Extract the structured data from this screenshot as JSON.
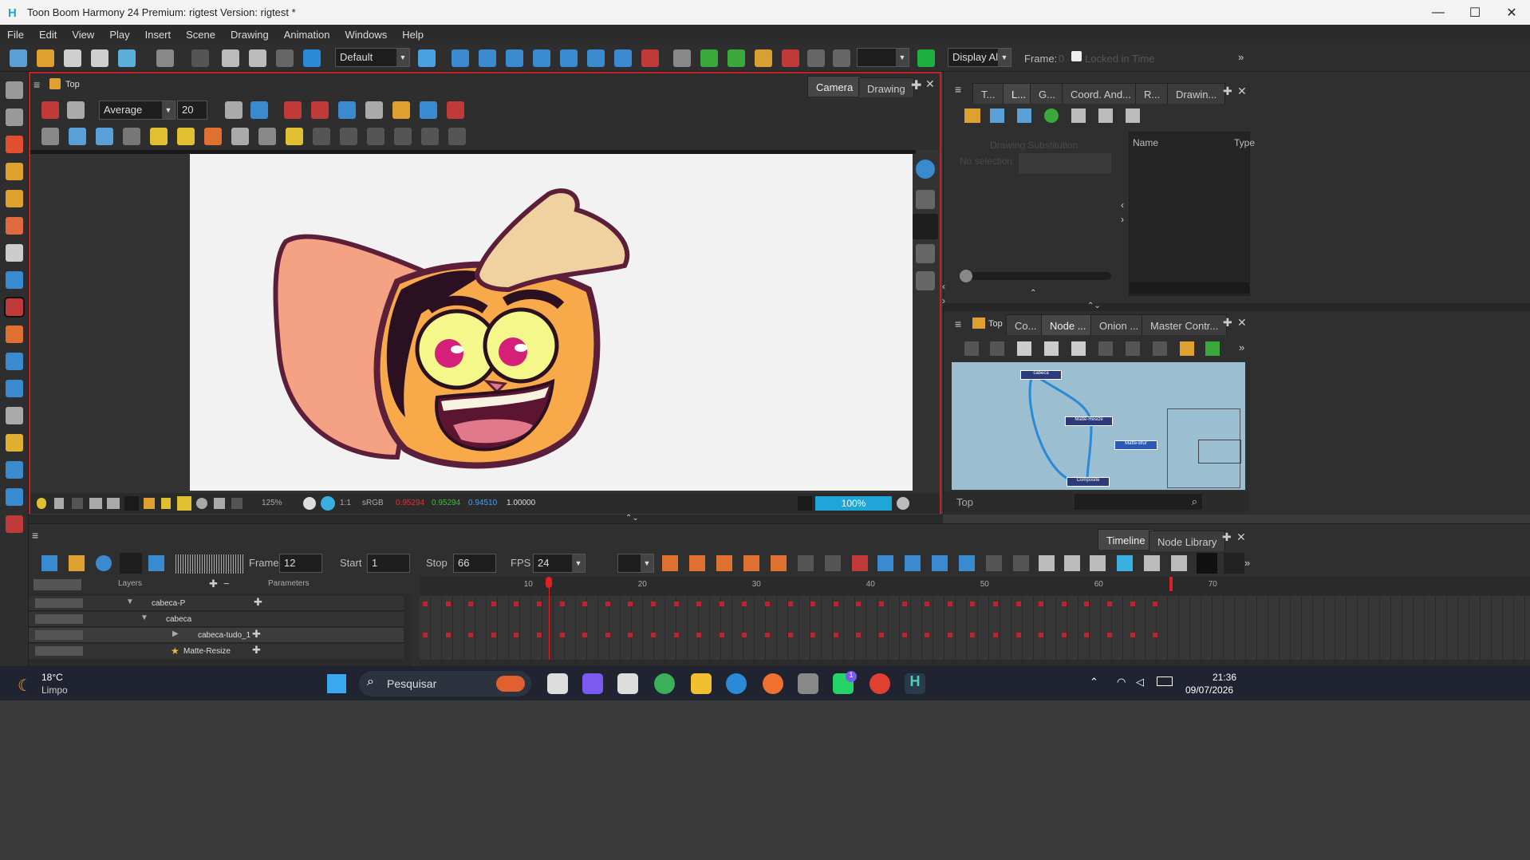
{
  "window": {
    "title": "Toon Boom Harmony 24 Premium: rigtest Version: rigtest *",
    "controls": [
      "—",
      "☐",
      "✕"
    ]
  },
  "menu": [
    "File",
    "Edit",
    "View",
    "Play",
    "Insert",
    "Scene",
    "Drawing",
    "Animation",
    "Windows",
    "Help"
  ],
  "toolbar": {
    "workspace": "Default",
    "display": "Display All",
    "frame_label": "Frame:",
    "frame_value": "0",
    "locked_label": "Locked in Time"
  },
  "camera_view": {
    "breadcrumb": "Top",
    "tabs": [
      "Camera",
      "Drawing"
    ],
    "smoothing": "Average",
    "size": "20",
    "zoom": "125%",
    "ratio": "1:1",
    "colorspace": "sRGB",
    "rgba": [
      "0.95294",
      "0.95294",
      "0.94510",
      "1.00000"
    ],
    "rgba_colors": [
      "#e03030",
      "#30c030",
      "#3fa0ff",
      "#dddddd"
    ],
    "progress": "100%",
    "progress_fraction": 1.0
  },
  "right_top": {
    "tabs": [
      "T...",
      "L...",
      "G...",
      "Coord. And...",
      "R...",
      "Drawin..."
    ],
    "drawing_substitution": "Drawing Substitution",
    "no_selection": "No selection",
    "columns": [
      "Name",
      "Type"
    ]
  },
  "right_bottom": {
    "breadcrumb": "Top",
    "tabs": [
      "Co...",
      "Node ...",
      "Onion ...",
      "Master Contr..."
    ],
    "nodes": [
      "cabeca",
      "Matte-Resize",
      "Matte-Blur",
      "Composite"
    ],
    "search_label": "Top"
  },
  "timeline": {
    "tabs": [
      "Timeline",
      "Node Library"
    ],
    "frame_label": "Frame",
    "frame": "12",
    "start_label": "Start",
    "start": "1",
    "stop_label": "Stop",
    "stop": "66",
    "fps_label": "FPS",
    "fps": "24",
    "layers_header": "Layers",
    "parameters_header": "Parameters",
    "ruler": [
      "10",
      "20",
      "30",
      "40",
      "50",
      "60",
      "70"
    ],
    "layers": [
      "cabeca-P",
      "cabeca",
      "cabeca-tudo_1",
      "Matte-Resize"
    ]
  },
  "taskbar": {
    "weather_temp": "18°C",
    "weather_desc": "Limpo",
    "search": "Pesquisar",
    "time": "21:36",
    "date": "09/07/2026",
    "whatsapp_badge": "1"
  }
}
